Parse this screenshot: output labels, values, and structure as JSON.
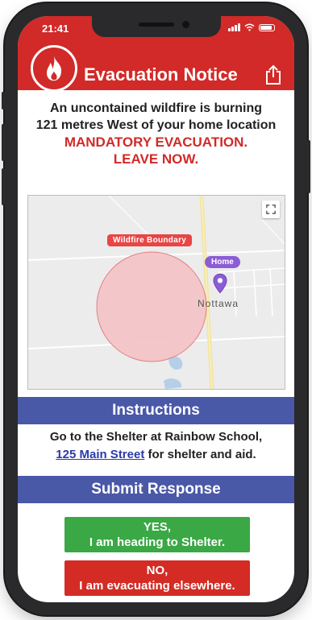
{
  "status_bar": {
    "time": "21:41"
  },
  "header": {
    "title": "Evacuation Notice",
    "logo_icon": "fire-icon",
    "share_icon": "share-icon"
  },
  "notice": {
    "line1": "An uncontained wildfire is burning",
    "line2": "121 metres West of your home location",
    "alert1": "MANDATORY EVACUATION.",
    "alert2": "LEAVE NOW."
  },
  "map": {
    "boundary_label": "Wildfire Boundary",
    "home_label": "Home",
    "town_label": "Nottawa",
    "fullscreen_icon": "fullscreen-icon",
    "marker_icon": "map-pin-icon"
  },
  "instructions": {
    "heading": "Instructions",
    "text_before": "Go to the Shelter at Rainbow School,",
    "link": "125 Main Street",
    "text_after": " for shelter and aid."
  },
  "response": {
    "heading": "Submit Response",
    "yes_line1": "YES,",
    "yes_line2": "I am heading to Shelter.",
    "no_line1": "NO,",
    "no_line2": "I am evacuating elsewhere."
  },
  "colors": {
    "header_red": "#d12a28",
    "section_blue": "#4a58a8",
    "yes_green": "#3aa845",
    "no_red": "#d42b25",
    "boundary_pink": "#f4c6c8",
    "home_purple": "#8b5cd6"
  }
}
